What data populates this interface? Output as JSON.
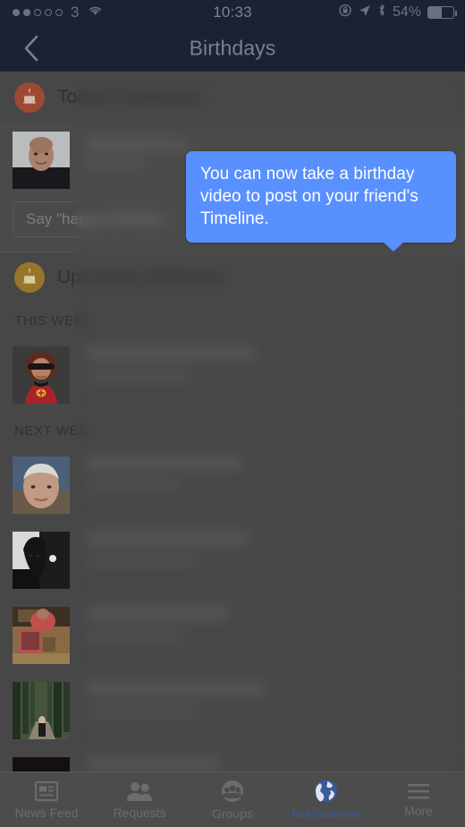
{
  "status_bar": {
    "signal_dots_filled": 2,
    "signal_dots_total": 5,
    "carrier": "3",
    "wifi_icon": "wifi-icon",
    "time": "10:33",
    "rotation_lock_icon": "rotation-lock-icon",
    "location_icon": "location-arrow-icon",
    "bluetooth_icon": "bluetooth-icon",
    "battery_percent": "54%",
    "battery_level": 54
  },
  "nav_bar": {
    "back_icon": "chevron-left-icon",
    "title": "Birthdays"
  },
  "today": {
    "icon": "birthday-cake-icon",
    "icon_color": "#9c4a33",
    "title": "Today's Birthdays",
    "friend": {
      "avatar": "profile-photo-man",
      "name_redacted": true
    },
    "composer": {
      "placeholder": "Say \"happy birthday\"...",
      "value": "",
      "video_icon": "movie-camera-icon",
      "messenger_icon": "messenger-icon"
    }
  },
  "tooltip": {
    "text": "You can now take a birthday video to post on your friend's Timeline.",
    "background": "#5890ff",
    "text_color": "#ffffff",
    "points_to": "movie-camera-icon"
  },
  "upcoming": {
    "icon": "birthday-cake-icon",
    "icon_color": "#97762a",
    "title": "Upcoming Birthdays",
    "groups": [
      {
        "label": "THIS WEEK",
        "rows": [
          {
            "avatar": "avatar-elastigirl-cartoon",
            "name_redacted": true
          }
        ]
      },
      {
        "label": "NEXT WEEK",
        "label_truncated": "NEXT WEE",
        "rows": [
          {
            "avatar": "avatar-older-man-white-hair",
            "name_redacted": true
          },
          {
            "avatar": "avatar-woman-black-and-white",
            "name_redacted": true
          },
          {
            "avatar": "avatar-person-red-shirt-table",
            "name_redacted": true
          },
          {
            "avatar": "avatar-person-forest-path",
            "name_redacted": true
          },
          {
            "avatar": "avatar-person-pink-dark",
            "name_redacted": true
          }
        ]
      }
    ]
  },
  "tab_bar": {
    "active_color": "#3b5998",
    "inactive_color": "#6c6c6c",
    "tabs": [
      {
        "label": "News Feed",
        "icon": "news-feed-icon",
        "active": false
      },
      {
        "label": "Requests",
        "icon": "friend-requests-icon",
        "active": false
      },
      {
        "label": "Groups",
        "icon": "groups-icon",
        "active": false
      },
      {
        "label": "Notifications",
        "icon": "globe-notifications-icon",
        "active": true
      },
      {
        "label": "More",
        "icon": "hamburger-more-icon",
        "active": false
      }
    ]
  }
}
